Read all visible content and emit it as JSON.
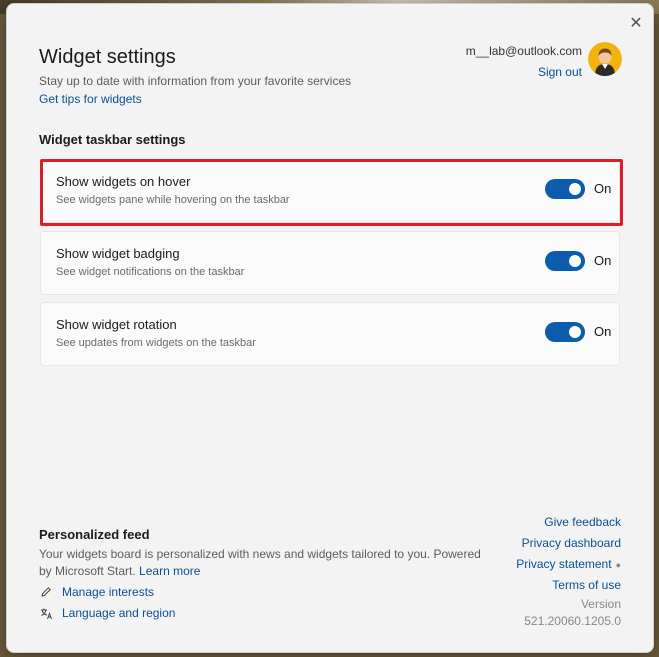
{
  "header": {
    "title": "Widget settings",
    "subtitle": "Stay up to date with information from your favorite services",
    "tips_link": "Get tips for widgets",
    "close_glyph": "✕"
  },
  "account": {
    "email": "m__lab@outlook.com",
    "sign_out": "Sign out"
  },
  "taskbar": {
    "heading": "Widget taskbar settings",
    "settings": [
      {
        "title": "Show widgets on hover",
        "description": "See widgets pane while hovering on the taskbar",
        "state": "On",
        "highlighted": true
      },
      {
        "title": "Show widget badging",
        "description": "See widget notifications on the taskbar",
        "state": "On",
        "highlighted": false
      },
      {
        "title": "Show widget rotation",
        "description": "See updates from widgets on the taskbar",
        "state": "On",
        "highlighted": false
      }
    ]
  },
  "feed": {
    "heading": "Personalized feed",
    "description": "Your widgets board is personalized with news and widgets tailored to you. Powered by Microsoft Start.",
    "learn_more": "Learn more",
    "manage_interests": "Manage interests",
    "language_region": "Language and region"
  },
  "footer_links": {
    "give_feedback": "Give feedback",
    "privacy_dashboard": "Privacy dashboard",
    "privacy_statement": "Privacy statement",
    "terms_of_use": "Terms of use",
    "version_label": "Version",
    "version_number": "521.20060.1205.0"
  },
  "colors": {
    "accent": "#0b5cad",
    "link": "#0b4f93",
    "highlight_border": "#d81f2c",
    "panel_bg": "#f3f3f3"
  },
  "icons": {
    "close": "close-icon",
    "avatar": "avatar",
    "pencil": "pencil-icon",
    "language": "language-icon"
  }
}
